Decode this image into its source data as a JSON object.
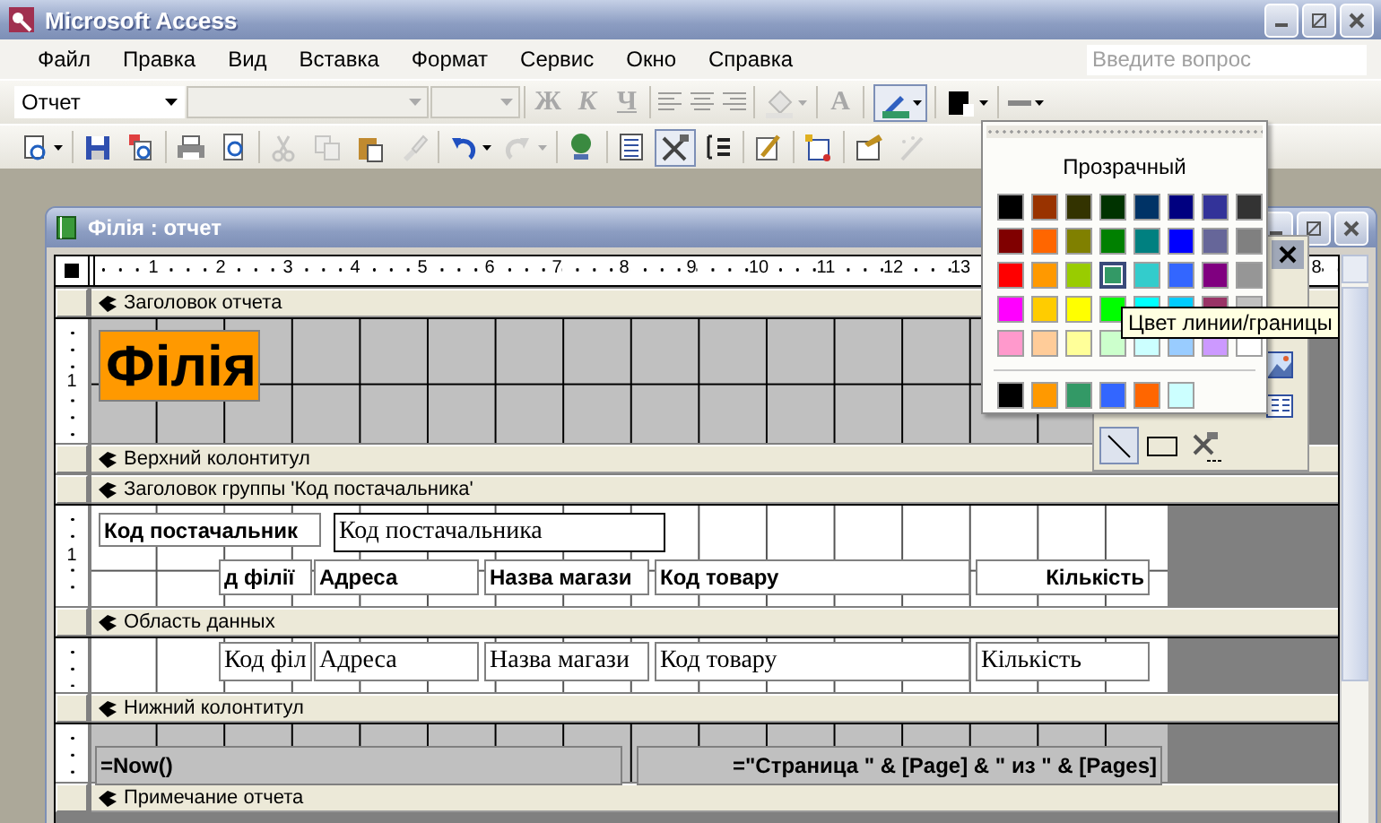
{
  "app": {
    "title": "Microsoft Access"
  },
  "menu": [
    {
      "label": "Файл"
    },
    {
      "label": "Правка"
    },
    {
      "label": "Вид"
    },
    {
      "label": "Вставка"
    },
    {
      "label": "Формат"
    },
    {
      "label": "Сервис"
    },
    {
      "label": "Окно"
    },
    {
      "label": "Справка"
    }
  ],
  "help": {
    "placeholder": "Введите вопрос"
  },
  "format_toolbar": {
    "object_combo": "Отчет",
    "font_combo_disabled": true,
    "size_combo_disabled": true,
    "text_buttons": [
      {
        "label": "Ж",
        "disabled": true
      },
      {
        "label": "К",
        "disabled": true
      },
      {
        "label": "Ч",
        "disabled": true
      }
    ],
    "font_color": {
      "label": "A",
      "disabled": true
    },
    "line_color": {
      "color": "#339966",
      "pressed": true
    }
  },
  "standard_toolbar": [
    {
      "kind": "view",
      "disabled": false,
      "pressed": false
    },
    {
      "kind": "save",
      "disabled": false,
      "pressed": false
    },
    {
      "kind": "search",
      "disabled": false,
      "pressed": false
    },
    {
      "kind": "print",
      "disabled": false,
      "pressed": false
    },
    {
      "kind": "preview",
      "disabled": false,
      "pressed": false
    },
    {
      "kind": "cut",
      "disabled": true,
      "pressed": false
    },
    {
      "kind": "copy",
      "disabled": true,
      "pressed": false
    },
    {
      "kind": "paste",
      "disabled": false,
      "pressed": false
    },
    {
      "kind": "brush",
      "disabled": true,
      "pressed": false
    },
    {
      "kind": "undo",
      "disabled": false,
      "pressed": false
    },
    {
      "kind": "redo",
      "disabled": true,
      "pressed": false
    },
    {
      "kind": "globe",
      "disabled": false,
      "pressed": false
    },
    {
      "kind": "list",
      "disabled": false,
      "pressed": false
    },
    {
      "kind": "tools",
      "disabled": false,
      "pressed": true
    },
    {
      "kind": "sorting",
      "disabled": false,
      "pressed": false
    },
    {
      "kind": "pencil",
      "disabled": false,
      "pressed": false
    },
    {
      "kind": "build",
      "disabled": false,
      "pressed": false
    },
    {
      "kind": "properties",
      "disabled": false,
      "pressed": false
    },
    {
      "kind": "wand",
      "disabled": true,
      "pressed": false
    }
  ],
  "palette": {
    "transparent": "Прозрачный",
    "colors": [
      {
        "color": "#000000",
        "selected": false
      },
      {
        "color": "#993300",
        "selected": false
      },
      {
        "color": "#333300",
        "selected": false
      },
      {
        "color": "#003300",
        "selected": false
      },
      {
        "color": "#003366",
        "selected": false
      },
      {
        "color": "#000080",
        "selected": false
      },
      {
        "color": "#333399",
        "selected": false
      },
      {
        "color": "#333333",
        "selected": false
      },
      {
        "color": "#800000",
        "selected": false
      },
      {
        "color": "#ff6600",
        "selected": false
      },
      {
        "color": "#808000",
        "selected": false
      },
      {
        "color": "#008000",
        "selected": false
      },
      {
        "color": "#008080",
        "selected": false
      },
      {
        "color": "#0000ff",
        "selected": false
      },
      {
        "color": "#666699",
        "selected": false
      },
      {
        "color": "#808080",
        "selected": false
      },
      {
        "color": "#ff0000",
        "selected": false
      },
      {
        "color": "#ff9900",
        "selected": false
      },
      {
        "color": "#99cc00",
        "selected": false
      },
      {
        "color": "#339966",
        "selected": true
      },
      {
        "color": "#33cccc",
        "selected": false
      },
      {
        "color": "#3366ff",
        "selected": false
      },
      {
        "color": "#800080",
        "selected": false
      },
      {
        "color": "#969696",
        "selected": false
      },
      {
        "color": "#ff00ff",
        "selected": false
      },
      {
        "color": "#ffcc00",
        "selected": false
      },
      {
        "color": "#ffff00",
        "selected": false
      },
      {
        "color": "#00ff00",
        "selected": false
      },
      {
        "color": "#00ffff",
        "selected": false
      },
      {
        "color": "#00ccff",
        "selected": false
      },
      {
        "color": "#993366",
        "selected": false
      },
      {
        "color": "#c0c0c0",
        "selected": false
      },
      {
        "color": "#ff99cc",
        "selected": false
      },
      {
        "color": "#ffcc99",
        "selected": false
      },
      {
        "color": "#ffff99",
        "selected": false
      },
      {
        "color": "#ccffcc",
        "selected": false
      },
      {
        "color": "#ccffff",
        "selected": false
      },
      {
        "color": "#99ccff",
        "selected": false
      },
      {
        "color": "#cc99ff",
        "selected": false
      },
      {
        "color": "#ffffff",
        "selected": false
      }
    ],
    "recent": [
      {
        "color": "#000000"
      },
      {
        "color": "#ff9900"
      },
      {
        "color": "#339966"
      },
      {
        "color": "#3366ff"
      },
      {
        "color": "#ff6600"
      },
      {
        "color": "#ccffff"
      }
    ]
  },
  "tooltip": "Цвет линии/границы",
  "toolbox": {
    "tools": [
      {
        "kind": "line",
        "pressed": true
      },
      {
        "kind": "rectangle",
        "pressed": false
      },
      {
        "kind": "more",
        "pressed": false
      }
    ]
  },
  "report": {
    "title": "Філія : отчет",
    "ruler": [
      "1",
      "2",
      "3",
      "4",
      "5",
      "6",
      "7",
      "8",
      "9",
      "10",
      "11",
      "12",
      "13"
    ],
    "ruler_tail": "8",
    "sections": [
      {
        "title": "Заголовок отчета",
        "kind": "shaded",
        "ruler_mark": "1",
        "controls": [
          {
            "kind": "title",
            "text": "Філія"
          }
        ]
      },
      {
        "title": "Верхний колонтитул",
        "kind": "band"
      },
      {
        "title": "Заголовок группы 'Код постачальника'",
        "kind": "plain",
        "ruler_mark": "1",
        "controls": [
          {
            "kind": "label",
            "text": "Код постачальник",
            "right_aligned": false
          },
          {
            "kind": "textbox",
            "text": "Код постачальника",
            "right_aligned": false
          },
          {
            "kind": "label",
            "text": "д філії",
            "right_aligned": false
          },
          {
            "kind": "label",
            "text": "Адреса",
            "right_aligned": false
          },
          {
            "kind": "label",
            "text": "Назва магази",
            "right_aligned": false
          },
          {
            "kind": "label",
            "text": "Код товару",
            "right_aligned": false
          },
          {
            "kind": "label",
            "text": "Кількість",
            "right_aligned": true
          }
        ]
      },
      {
        "title": "Область данных",
        "kind": "plain",
        "controls": [
          {
            "kind": "field",
            "text": "Код філ",
            "right_aligned": false
          },
          {
            "kind": "field",
            "text": "Адреса",
            "right_aligned": false
          },
          {
            "kind": "field",
            "text": "Назва магази",
            "right_aligned": false
          },
          {
            "kind": "field",
            "text": "Код товару",
            "right_aligned": false
          },
          {
            "kind": "field",
            "text": "Кількість",
            "right_aligned": false
          }
        ]
      },
      {
        "title": "Нижний колонтитул",
        "kind": "shaded",
        "controls": [
          {
            "kind": "label",
            "text": "=Now()",
            "right_aligned": false
          },
          {
            "kind": "label",
            "text": "=\"Страница \" & [Page] & \" из \" & [Pages]",
            "right_aligned": true
          }
        ]
      },
      {
        "title": "Примечание отчета",
        "kind": "band"
      }
    ]
  }
}
